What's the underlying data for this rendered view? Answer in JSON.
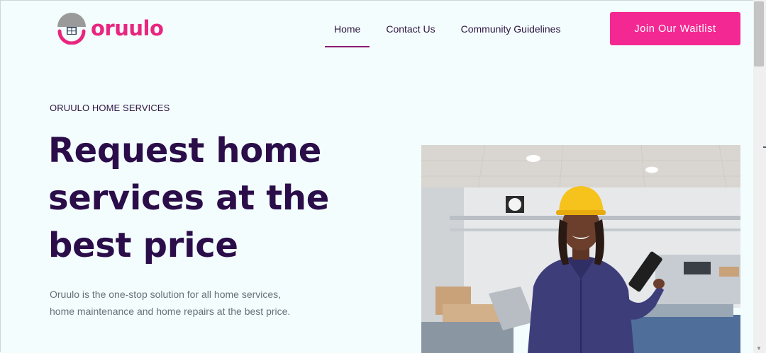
{
  "brand": {
    "name": "oruulo",
    "accent": "#e8267f",
    "dark": "#2b0d4a",
    "logo_icon": "house-roof-icon"
  },
  "nav": {
    "items": [
      {
        "label": "Home",
        "active": true
      },
      {
        "label": "Contact Us",
        "active": false
      },
      {
        "label": "Community Guidelines",
        "active": false
      }
    ],
    "cta_label": "Join Our Waitlist"
  },
  "hero": {
    "eyebrow": "ORUULO HOME SERVICES",
    "headline_lines": [
      "Request home",
      "services at the",
      "best price"
    ],
    "description": "Oruulo is the one-stop solution for all home services, home maintenance and home repairs at the best price.",
    "image_icon": "factory-worker-photo"
  }
}
